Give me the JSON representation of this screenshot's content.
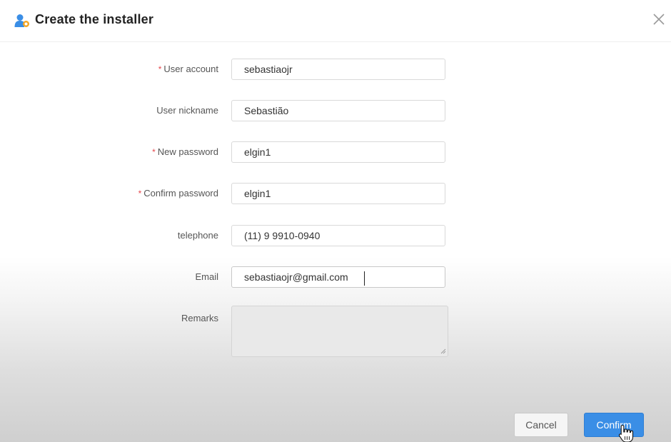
{
  "dialog": {
    "title": "Create the installer",
    "title_icon": "user-add-icon",
    "close_icon": "close-icon"
  },
  "form": {
    "fields": [
      {
        "label": "User account",
        "required": true,
        "value": "sebastiaojr"
      },
      {
        "label": "User nickname",
        "required": false,
        "value": "Sebastião"
      },
      {
        "label": "New password",
        "required": true,
        "value": "elgin1"
      },
      {
        "label": "Confirm password",
        "required": true,
        "value": "elgin1"
      },
      {
        "label": "telephone",
        "required": false,
        "value": "(11) 9 9910-0940"
      },
      {
        "label": "Email",
        "required": false,
        "value": "sebastiaojr@gmail.com"
      }
    ],
    "remarks": {
      "label": "Remarks",
      "value": ""
    }
  },
  "footer": {
    "cancel_label": "Cancel",
    "confirm_label": "Confirm"
  },
  "colors": {
    "primary": "#3a8ee6",
    "required_marker": "#e5484d"
  }
}
